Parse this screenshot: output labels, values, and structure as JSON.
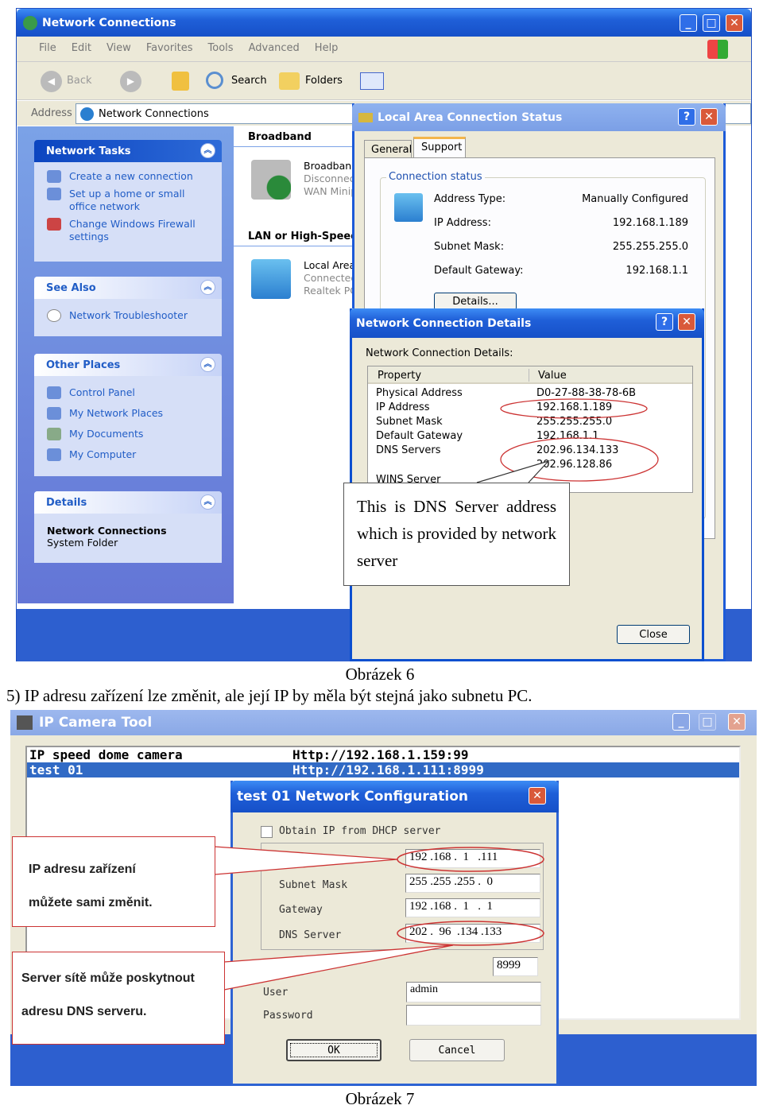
{
  "figure6": {
    "window_title": "Network Connections",
    "menu": [
      "File",
      "Edit",
      "View",
      "Favorites",
      "Tools",
      "Advanced",
      "Help"
    ],
    "toolbar": {
      "back": "Back",
      "search": "Search",
      "folders": "Folders"
    },
    "address": {
      "label": "Address",
      "value": "Network Connections"
    },
    "network_tasks": {
      "title": "Network Tasks",
      "items": [
        "Create a new connection",
        "Set up a home or small office network",
        "Change Windows Firewall settings"
      ]
    },
    "see_also": {
      "title": "See Also",
      "items": [
        "Network Troubleshooter"
      ]
    },
    "other_places": {
      "title": "Other Places",
      "items": [
        "Control Panel",
        "My Network Places",
        "My Documents",
        "My Computer"
      ]
    },
    "details": {
      "title": "Details",
      "name": "Network Connections",
      "type": "System Folder"
    },
    "groups": [
      {
        "title": "Broadband",
        "item": {
          "name": "Broadband",
          "status": "Disconnected",
          "device": "WAN Minip"
        }
      },
      {
        "title": "LAN or High-Speed",
        "item": {
          "name": "Local Area",
          "status": "Connected",
          "device": "Realtek PC"
        }
      }
    ],
    "status_dialog": {
      "title": "Local Area Connection Status",
      "tabs": [
        "General",
        "Support"
      ],
      "group": "Connection status",
      "rows": [
        {
          "label": "Address Type:",
          "value": "Manually Configured"
        },
        {
          "label": "IP Address:",
          "value": "192.168.1.189"
        },
        {
          "label": "Subnet Mask:",
          "value": "255.255.255.0"
        },
        {
          "label": "Default Gateway:",
          "value": "192.168.1.1"
        }
      ],
      "details_button": "Details..."
    },
    "details_dialog": {
      "title": "Network Connection Details",
      "label": "Network Connection Details:",
      "columns": [
        "Property",
        "Value"
      ],
      "rows": [
        [
          "Physical Address",
          "D0-27-88-38-78-6B"
        ],
        [
          "IP Address",
          "192.168.1.189"
        ],
        [
          "Subnet Mask",
          "255.255.255.0"
        ],
        [
          "Default Gateway",
          "192.168.1.1"
        ],
        [
          "DNS Servers",
          "202.96.134.133"
        ],
        [
          "",
          "202.96.128.86"
        ],
        [
          "WINS Server",
          ""
        ]
      ],
      "close": "Close"
    },
    "callout": "This is DNS Server address which is provided by network server",
    "caption": "Obrázek 6"
  },
  "paragraph": "5) IP adresu zařízení lze změnit, ale její IP by měla být stejná jako subnetu PC.",
  "figure7": {
    "window_title": "IP Camera Tool",
    "list": [
      {
        "name": "IP speed dome camera",
        "url": "Http://192.168.1.159:99"
      },
      {
        "name": "test 01",
        "url": "Http://192.168.1.111:8999",
        "selected": true
      }
    ],
    "dialog": {
      "title": "test 01 Network Configuration",
      "dhcp": "Obtain IP from DHCP server",
      "dhcp_checked": false,
      "ip": "192 .168 .  1   .111",
      "subnet_label": "Subnet Mask",
      "subnet": "255 .255 .255 .  0",
      "gateway_label": "Gateway",
      "gateway": "192 .168 .  1   .  1",
      "dns_label": "DNS Server",
      "dns": "202 .  96  .134 .133",
      "port": "8999",
      "user_label": "User",
      "user": "admin",
      "password_label": "Password",
      "password": "",
      "ok": "OK",
      "cancel": "Cancel"
    },
    "callout1": [
      "IP adresu zařízení",
      "můžete sami změnit."
    ],
    "callout2": [
      "Server sítě může poskytnout",
      "adresu DNS serveru."
    ],
    "caption": "Obrázek 7"
  },
  "colors": {
    "xp_blue": "#1f5fd8",
    "dialog_face": "#ece9d8",
    "annotation_red": "#cc3333",
    "selection": "#316ac5"
  }
}
